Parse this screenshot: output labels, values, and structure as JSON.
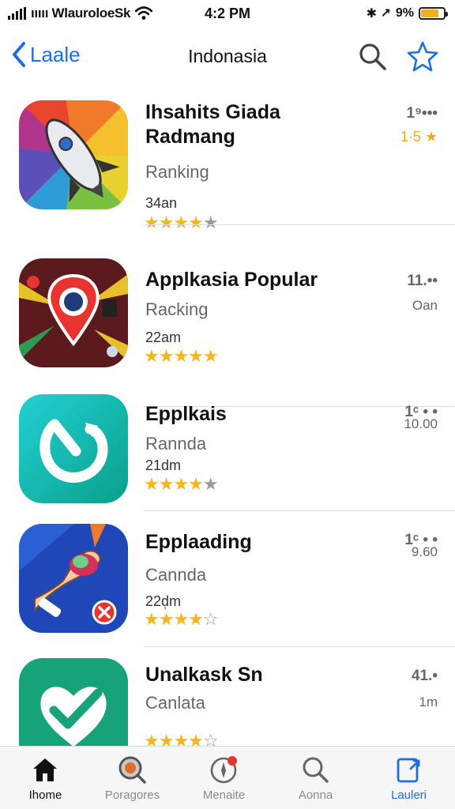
{
  "status_bar": {
    "carrier": "ııııı WlauroloeSk",
    "time": "4:2 PM",
    "battery_text": "9%",
    "bt_text": "✱ ↗",
    "battery_color": "#f2b01e"
  },
  "nav": {
    "back_label": "Laale",
    "title": "Indonasia",
    "accent": "#1c6fe0"
  },
  "apps": [
    {
      "name_line1": "Ihsahits Giada",
      "name_line2": "Radmang",
      "subtitle": "Ranking",
      "meta": "34an",
      "stars": "4.5",
      "side_top": "1⁹•••",
      "side_bottom": "1·5 ★"
    },
    {
      "name_line1": "Applkasia Popular",
      "name_line2": "",
      "subtitle": "Racking",
      "meta": "22am",
      "stars": "5",
      "side_top": "11.••",
      "side_bottom": "Oan"
    },
    {
      "name_line1": "Epplkais",
      "name_line2": "",
      "subtitle": "Rannda",
      "meta": "21dm",
      "stars": "4.5",
      "side_top": "1ᶜ • •",
      "side_bottom": "10.00"
    },
    {
      "name_line1": "Epplaading",
      "name_line2": "",
      "subtitle": "Cannda",
      "meta": "22d̹m",
      "stars": "4",
      "side_top": "1ᶜ • •",
      "side_bottom": "9.60"
    },
    {
      "name_line1": "Unalkask Sn",
      "name_line2": "",
      "subtitle": "Canlata",
      "meta": "",
      "stars": "4",
      "side_top": "41.•",
      "side_bottom": "1m"
    }
  ],
  "tabs": [
    {
      "label": "Ihome",
      "icon": "home-icon"
    },
    {
      "label": "Poragores",
      "icon": "categories-search-icon"
    },
    {
      "label": "Menaite",
      "icon": "notification-compass-icon"
    },
    {
      "label": "Aonna",
      "icon": "search-icon"
    },
    {
      "label": "Lauleri",
      "icon": "updates-icon"
    }
  ]
}
